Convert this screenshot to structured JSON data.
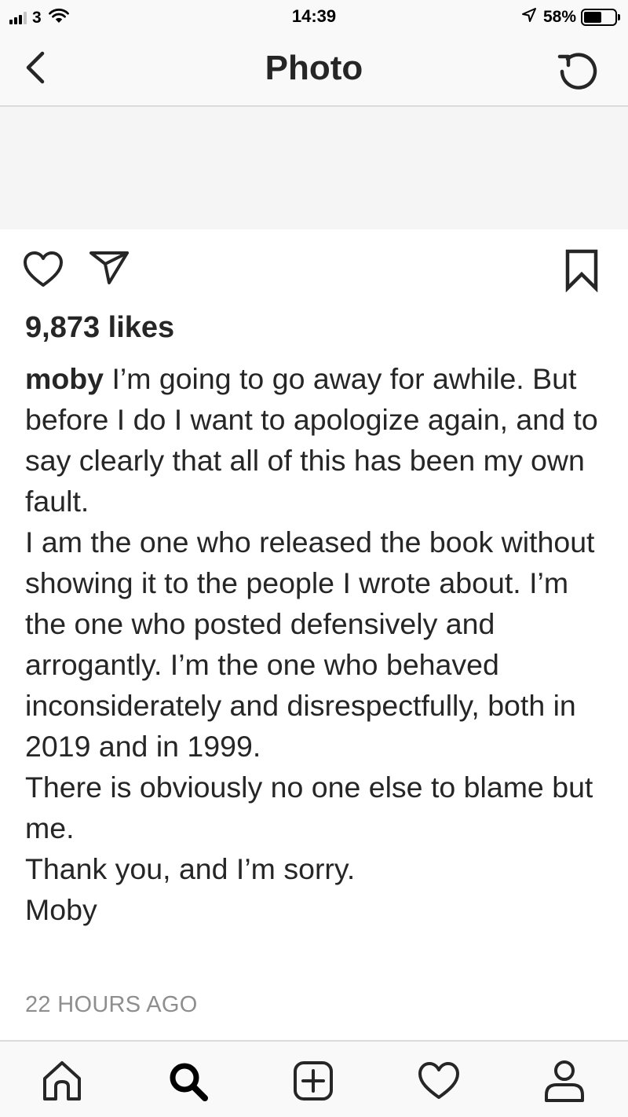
{
  "status_bar": {
    "carrier": "3",
    "time": "14:39",
    "battery_percent_label": "58%",
    "battery_level": 0.58,
    "signal_bars_active": 3,
    "signal_bars_total": 4,
    "icons": [
      "signal-bars-icon",
      "wifi-icon",
      "location-arrow-icon",
      "battery-icon"
    ]
  },
  "nav": {
    "title": "Photo",
    "left_icon": "chevron-left-icon",
    "right_icon": "refresh-icon"
  },
  "post": {
    "likes": "9,873 likes",
    "username": "moby",
    "caption_paragraphs": [
      "I’m going to go away for awhile. But before I do I want to apologize again, and to say clearly that all of this has been my own fault.",
      "I am the one who released the book without showing it to the people I wrote about. I’m the one who posted defensively and arrogantly. I’m the one who behaved inconsiderately and disrespectfully, both in 2019 and in 1999.",
      "There is obviously no one else to blame but me.",
      "Thank you, and I’m sorry.",
      "Moby"
    ],
    "timestamp": "22 HOURS AGO",
    "action_icons": [
      "heart-icon",
      "paper-plane-icon",
      "bookmark-icon"
    ]
  },
  "tab_bar": {
    "tabs": [
      "home-icon",
      "search-icon",
      "new-post-icon",
      "activity-heart-icon",
      "profile-icon"
    ]
  },
  "colors": {
    "text": "#262626",
    "secondary_text": "#8e8e8e",
    "bar_background": "#f9f9f9",
    "divider": "#dbdbdb"
  }
}
